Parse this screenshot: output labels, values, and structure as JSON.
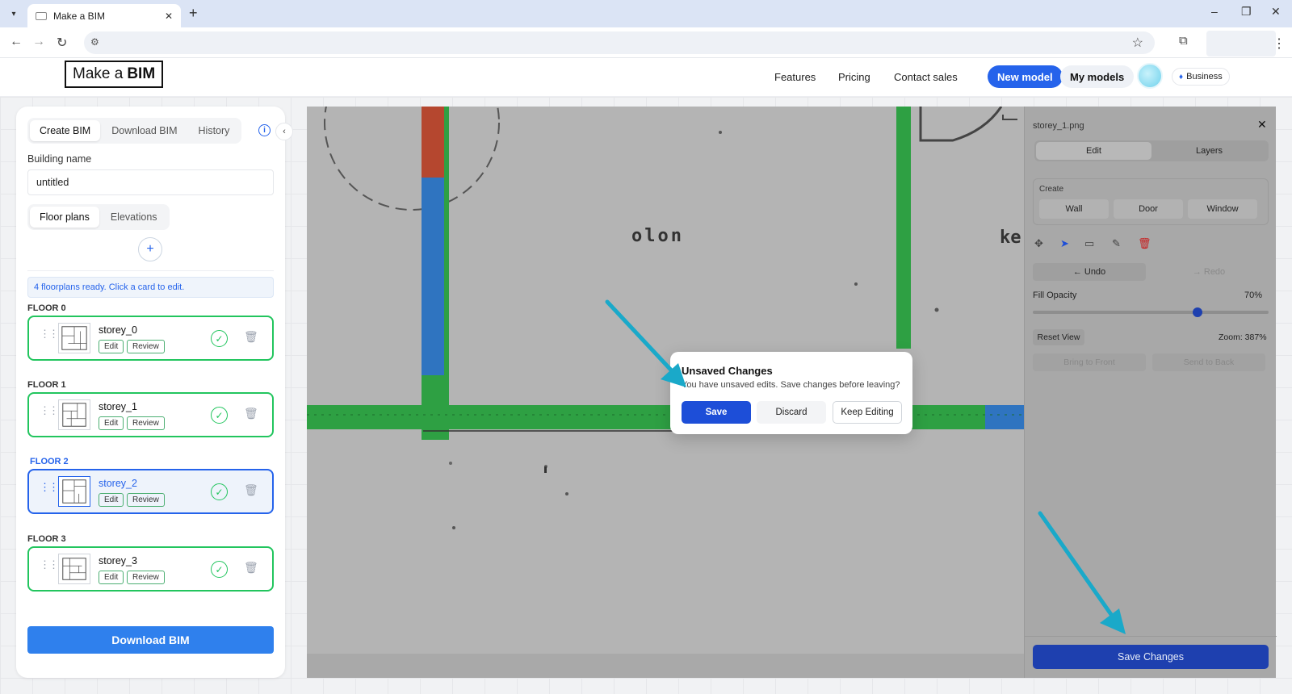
{
  "browser": {
    "tab_title": "Make a BIM",
    "close_glyph": "✕",
    "new_tab_glyph": "+",
    "controls": {
      "minimize": "–",
      "restore": "❐",
      "close": "✕"
    }
  },
  "header": {
    "logo_prefix": "Make a",
    "logo_bold": "BIM",
    "nav": [
      "Features",
      "Pricing",
      "Contact sales"
    ],
    "new_model": "New model",
    "my_models": "My models",
    "plan_badge": "Business"
  },
  "left_panel": {
    "tabs": [
      "Create BIM",
      "Download BIM",
      "History"
    ],
    "active_tab": "Create BIM",
    "building_name_label": "Building name",
    "building_name_value": "untitled",
    "plan_tabs": [
      "Floor plans",
      "Elevations"
    ],
    "notice": "4 floorplans ready. Click a card to edit.",
    "floors": [
      {
        "label": "FLOOR 0",
        "name": "storey_0",
        "selected": false
      },
      {
        "label": "FLOOR 1",
        "name": "storey_1",
        "selected": false
      },
      {
        "label": "FLOOR 2",
        "name": "storey_2",
        "selected": true
      },
      {
        "label": "FLOOR 3",
        "name": "storey_3",
        "selected": false
      }
    ],
    "edit_label": "Edit",
    "review_label": "Review",
    "download_button": "Download BIM"
  },
  "canvas": {
    "room_label": "olon",
    "edge_label": "ke"
  },
  "editor": {
    "file_name": "storey_1.png",
    "tabs": [
      "Edit",
      "Layers"
    ],
    "active_tab": "Edit",
    "create_label": "Create",
    "create_buttons": [
      "Wall",
      "Door",
      "Window"
    ],
    "undo": "Undo",
    "redo": "Redo",
    "fill_opacity_label": "Fill Opacity",
    "fill_opacity_value": "70%",
    "reset_view": "Reset View",
    "zoom": "Zoom: 387%",
    "bring_to_front": "Bring to Front",
    "send_to_back": "Send to Back",
    "save_changes": "Save Changes"
  },
  "modal": {
    "title": "Unsaved Changes",
    "message": "You have unsaved edits. Save changes before leaving?",
    "save": "Save",
    "discard": "Discard",
    "keep_editing": "Keep Editing"
  },
  "colors": {
    "primary": "#2563eb",
    "wall_green": "#2ea043",
    "wall_blue": "#2f74c0",
    "wall_red": "#b5472f",
    "annotation_arrow": "#1aa9c9",
    "save_changes": "#1e40af"
  }
}
